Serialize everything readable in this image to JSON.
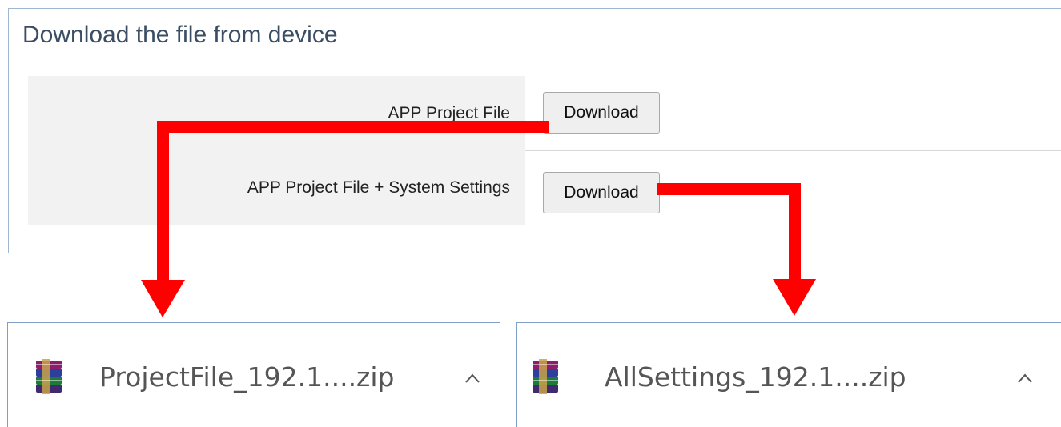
{
  "panel": {
    "title": "Download the file from device",
    "rows": [
      {
        "label": "APP Project File",
        "button_label": "Download"
      },
      {
        "label": "APP Project File + System Settings",
        "button_label": "Download"
      }
    ]
  },
  "downloads": [
    {
      "file_name": "ProjectFile_192.1....zip",
      "icon": "winrar-archive-icon"
    },
    {
      "file_name": "AllSettings_192.1....zip",
      "icon": "winrar-archive-icon"
    }
  ],
  "colors": {
    "arrow": "#ff0000",
    "panel_border": "#9fb6cf",
    "download_border": "#7f9fc5",
    "title_text": "#3a4d63"
  }
}
